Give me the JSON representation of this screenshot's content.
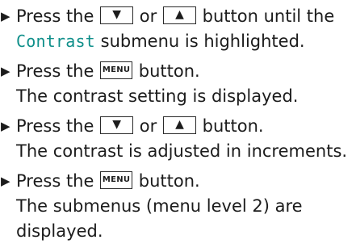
{
  "bullet_glyph": "▶",
  "down_arrow": "▼",
  "up_arrow": "▲",
  "menu_key": "MENU",
  "submenu_color": "#0f8f8a",
  "steps": [
    {
      "l1_a": "Press the",
      "l1_b": "or",
      "l1_c": "button until the",
      "l2_term": "Contrast",
      "l2_rest": "submenu is highlighted."
    },
    {
      "l1_a": "Press the",
      "l1_b": "button.",
      "l2": "The contrast setting is displayed."
    },
    {
      "l1_a": "Press the",
      "l1_b": "or",
      "l1_c": "button.",
      "l2": "The contrast is adjusted in increments."
    },
    {
      "l1_a": "Press the",
      "l1_b": "button.",
      "l2": "The submenus (menu level 2) are",
      "l3": "displayed."
    }
  ]
}
